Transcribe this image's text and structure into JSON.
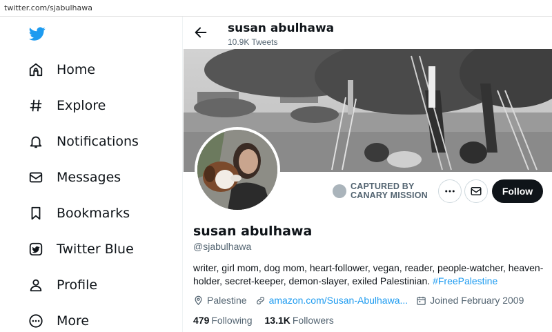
{
  "browser": {
    "url": "twitter.com/sjabulhawa"
  },
  "sidebar": {
    "items": [
      {
        "label": "Home",
        "icon": "home-icon"
      },
      {
        "label": "Explore",
        "icon": "hashtag-icon"
      },
      {
        "label": "Notifications",
        "icon": "bell-icon"
      },
      {
        "label": "Messages",
        "icon": "envelope-icon"
      },
      {
        "label": "Bookmarks",
        "icon": "bookmark-icon"
      },
      {
        "label": "Twitter Blue",
        "icon": "twitter-blue-icon"
      },
      {
        "label": "Profile",
        "icon": "person-icon"
      },
      {
        "label": "More",
        "icon": "more-circle-icon"
      }
    ]
  },
  "header": {
    "name": "susan abulhawa",
    "tweets": "10.9K Tweets"
  },
  "captured": {
    "line1": "CAPTURED BY",
    "line2": "CANARY MISSION"
  },
  "actions": {
    "follow": "Follow"
  },
  "profile": {
    "name": "susan abulhawa",
    "handle": "@sjabulhawa",
    "bio_text": "writer, girl mom, dog mom, heart-follower, vegan, reader, people-watcher, heaven-holder, secret-keeper, demon-slayer, exiled Palestinian. ",
    "bio_hashtag": "#FreePalestine",
    "location": "Palestine",
    "link": "amazon.com/Susan-Abulhawa...",
    "joined": "Joined February 2009",
    "following_count": "479",
    "following_label": "Following",
    "followers_count": "13.1K",
    "followers_label": "Followers"
  },
  "colors": {
    "accent": "#1d9bf0",
    "text": "#0f1419",
    "muted": "#536471",
    "follow_bg": "#0f1419"
  }
}
